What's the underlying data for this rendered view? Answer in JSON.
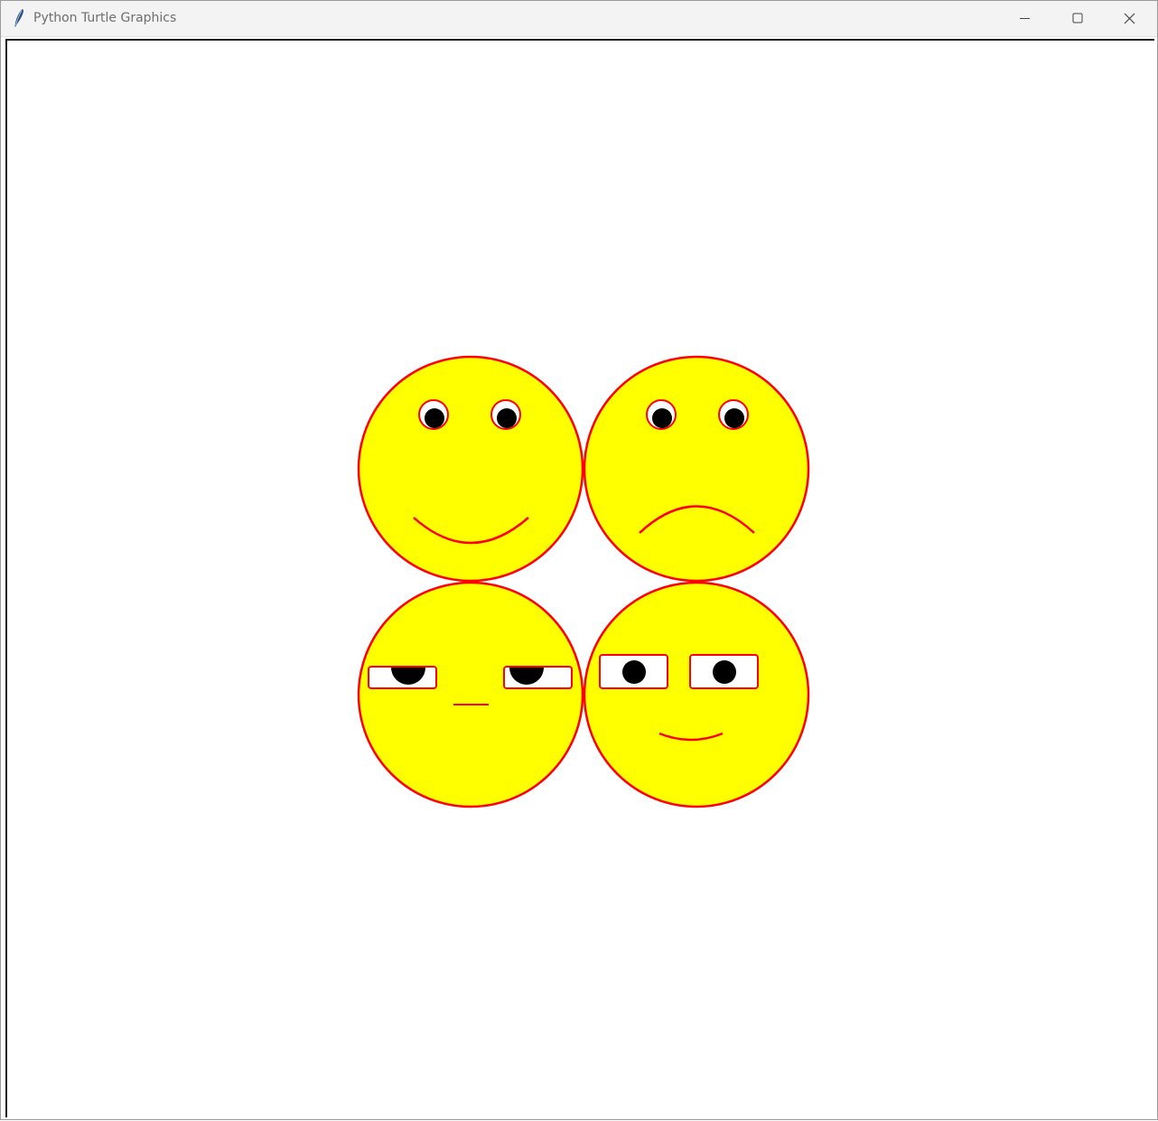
{
  "window": {
    "title": "Python Turtle Graphics",
    "app_icon": "feather-icon",
    "controls": {
      "minimize_icon": "minimize-icon",
      "maximize_icon": "maximize-icon",
      "close_icon": "close-icon"
    }
  },
  "canvas": {
    "background": "#ffffff",
    "faces": [
      {
        "name": "happy-face",
        "expression": "smile"
      },
      {
        "name": "sad-face",
        "expression": "frown"
      },
      {
        "name": "unamused-face",
        "expression": "half-closed eyes, flat mouth"
      },
      {
        "name": "smirk-face",
        "expression": "rectangular eyes, small smile"
      }
    ],
    "colors": {
      "face_fill": "#ffff00",
      "outline": "#ff0000",
      "pupil": "#000000",
      "eye_white": "#ffffff"
    }
  }
}
